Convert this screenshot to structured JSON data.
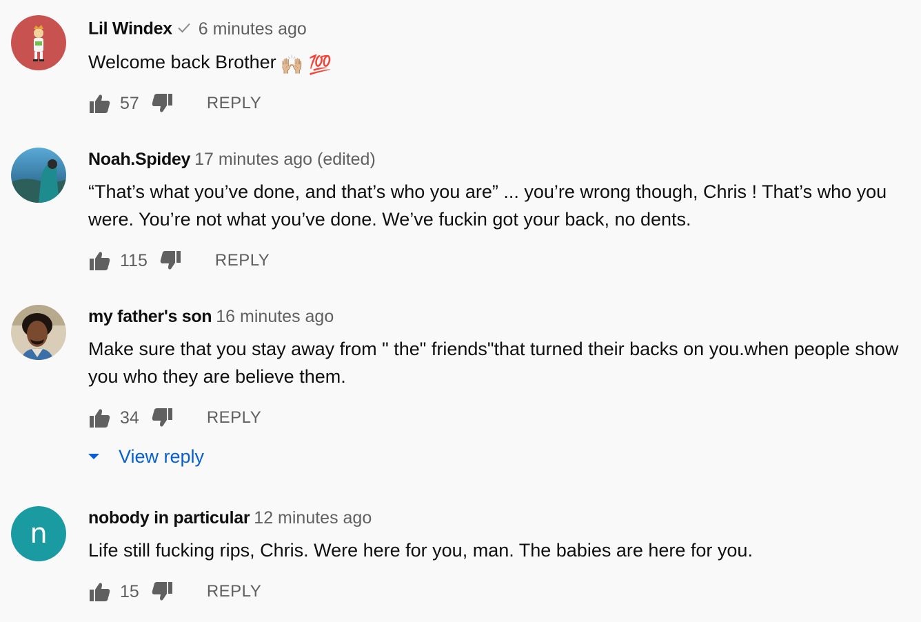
{
  "icons": {
    "like": "thumb-up-icon",
    "dislike": "thumb-down-icon",
    "verified": "check-icon",
    "expand": "caret-down-icon"
  },
  "colors": {
    "link_blue": "#065fd4",
    "meta_gray": "#606060",
    "avatar_teal": "#1a9ba2",
    "avatar_red": "#c8524f"
  },
  "comments": [
    {
      "author": "Lil Windex",
      "time": "6 minutes ago",
      "text": "Welcome back Brother",
      "emoji": "🙌🏼 💯",
      "likes": "57",
      "reply_label": "REPLY"
    },
    {
      "author": "Noah.Spidey",
      "time": "17 minutes ago (edited)",
      "text": "“That’s what you’ve done, and that’s who you are” ... you’re wrong though, Chris ! That’s who you were. You’re not what you’ve done. We’ve fuckin got your back, no dents.",
      "likes": "115",
      "reply_label": "REPLY"
    },
    {
      "author": "my father's son",
      "time": "16 minutes ago",
      "text": "Make sure that you stay away from \" the\" friends\"that turned their backs on you.when people show you who they are believe them.",
      "likes": "34",
      "reply_label": "REPLY",
      "view_replies_label": "View reply"
    },
    {
      "author": "nobody in particular",
      "avatar_letter": "n",
      "time": "12 minutes ago",
      "text": "Life still fucking rips, Chris. Were here for you, man. The babies are here for you.",
      "likes": "15",
      "reply_label": "REPLY"
    }
  ]
}
